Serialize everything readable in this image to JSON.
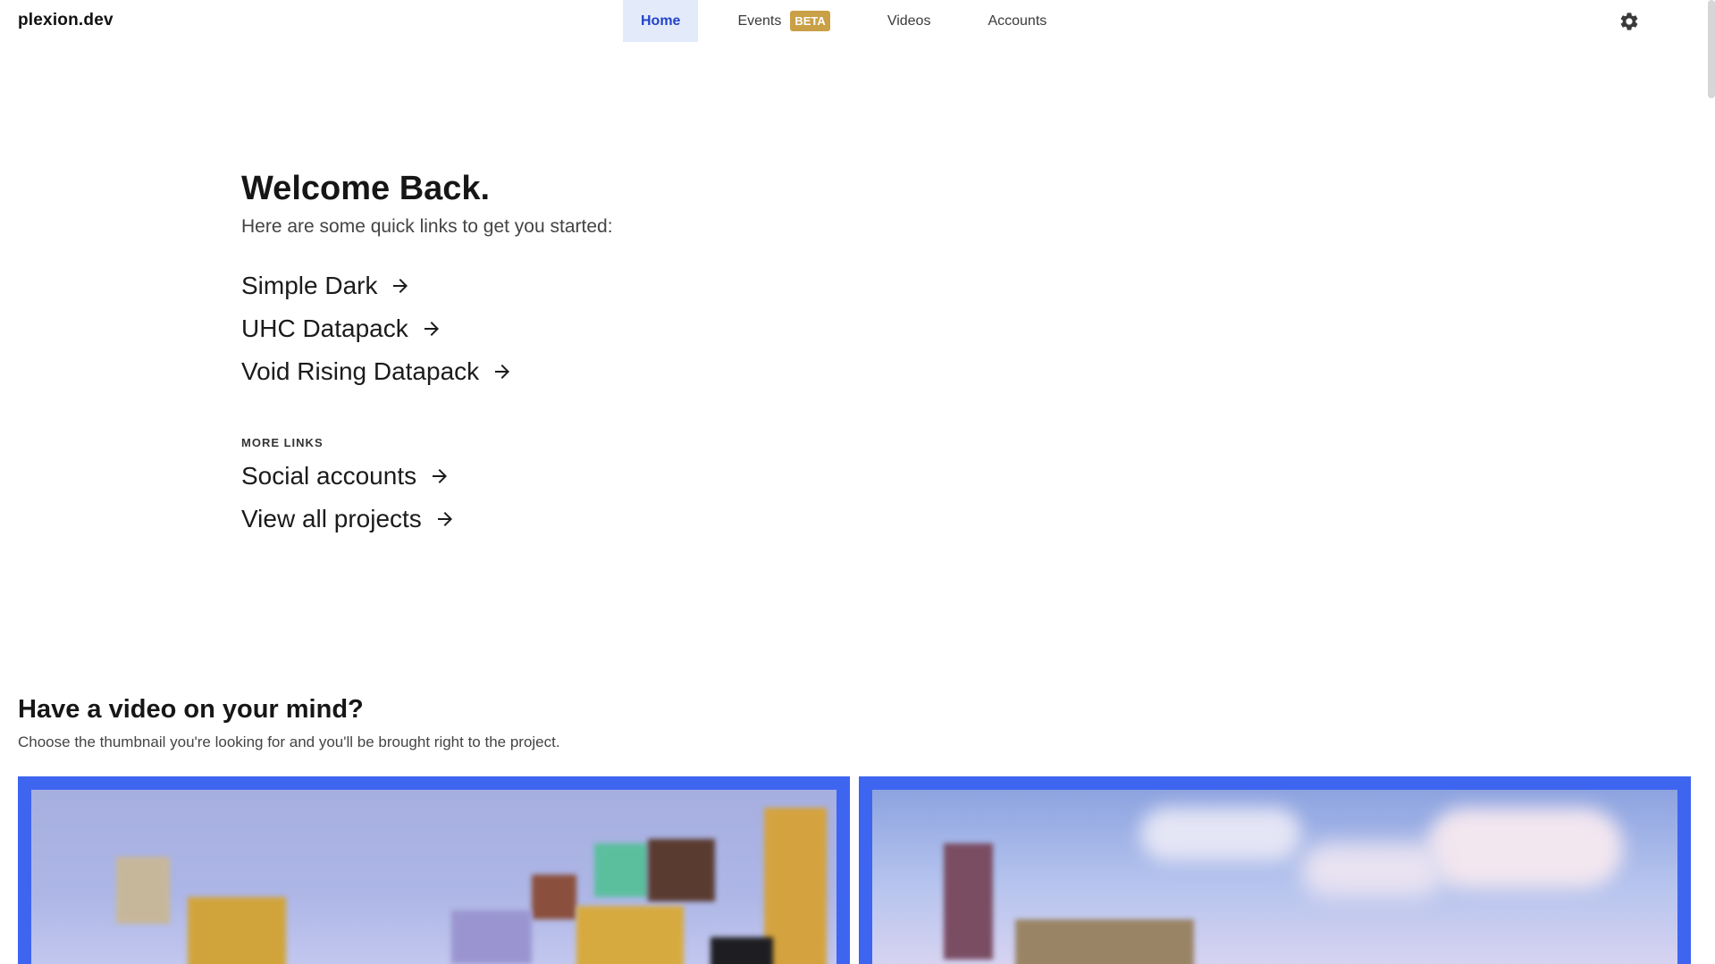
{
  "brand": "plexion.dev",
  "nav": {
    "home": "Home",
    "events": "Events",
    "events_badge": "BETA",
    "videos": "Videos",
    "accounts": "Accounts"
  },
  "hero": {
    "title": "Welcome Back.",
    "subtitle": "Here are some quick links to get you started:",
    "quick_links": [
      "Simple Dark",
      "UHC Datapack",
      "Void Rising Datapack"
    ],
    "more_label": "MORE LINKS",
    "more_links": [
      "Social accounts",
      "View all projects"
    ]
  },
  "video_section": {
    "title": "Have a video on your mind?",
    "subtitle": "Choose the thumbnail you're looking for and you'll be brought right to the project."
  },
  "colors": {
    "accent": "#3e65f0",
    "nav_active_bg": "#e3ebfb",
    "nav_active_text": "#2343c7",
    "beta_badge": "#c9a046"
  },
  "icons": {
    "settings": "gear-icon",
    "link_arrow": "arrow-right-icon"
  }
}
